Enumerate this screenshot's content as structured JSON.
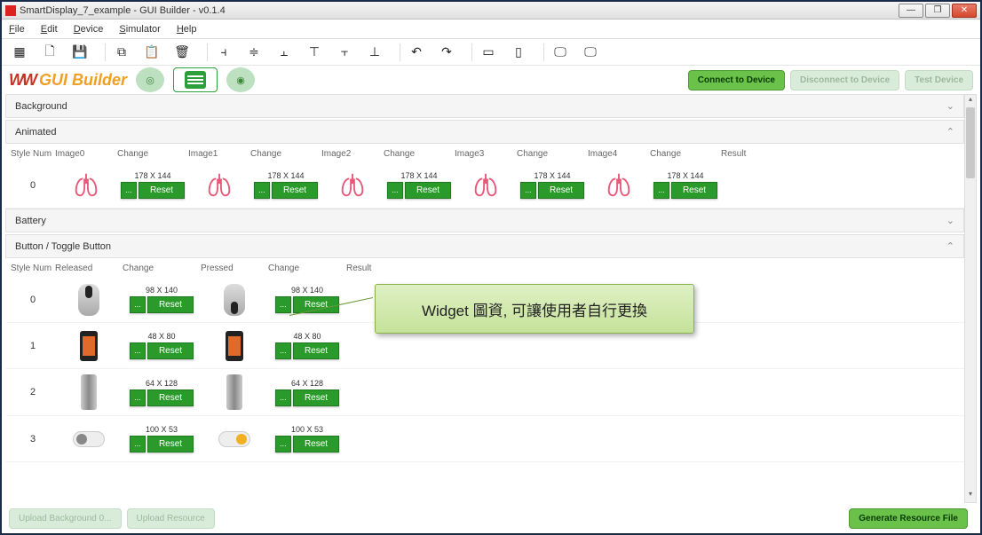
{
  "window": {
    "title": "SmartDisplay_7_example - GUI Builder - v0.1.4",
    "min": "—",
    "max": "❐",
    "close": "✕"
  },
  "menu": {
    "file": "File",
    "edit": "Edit",
    "device": "Device",
    "simulator": "Simulator",
    "help": "Help"
  },
  "logo": {
    "w": "WW",
    "text": "GUI Builder"
  },
  "actions": {
    "connect": "Connect to Device",
    "disconnect": "Disconnect to Device",
    "test": "Test Device"
  },
  "sections": {
    "background": "Background",
    "animated": "Animated",
    "battery": "Battery",
    "button": "Button / Toggle Button"
  },
  "cols_anim": {
    "style": "Style Num",
    "img0": "Image0",
    "chg": "Change",
    "img1": "Image1",
    "img2": "Image2",
    "img3": "Image3",
    "img4": "Image4",
    "result": "Result"
  },
  "cols_btn": {
    "style": "Style Num",
    "released": "Released",
    "chg": "Change",
    "pressed": "Pressed",
    "result": "Result"
  },
  "anim": {
    "row0": {
      "num": "0",
      "dim": "178 X 144",
      "dots": "...",
      "reset": "Reset"
    }
  },
  "btn": {
    "r0": {
      "num": "0",
      "dim": "98 X 140",
      "dots": "...",
      "reset": "Reset"
    },
    "r1": {
      "num": "1",
      "dim": "48 X 80",
      "dots": "...",
      "reset": "Reset"
    },
    "r2": {
      "num": "2",
      "dim": "64 X 128",
      "dots": "...",
      "reset": "Reset"
    },
    "r3": {
      "num": "3",
      "dim": "100 X 53",
      "dots": "...",
      "reset": "Reset"
    }
  },
  "callout": "Widget 圖資, 可讓使用者自行更換",
  "footer": {
    "upload_bg": "Upload Background 0...",
    "upload_res": "Upload Resource",
    "generate": "Generate Resource File"
  }
}
